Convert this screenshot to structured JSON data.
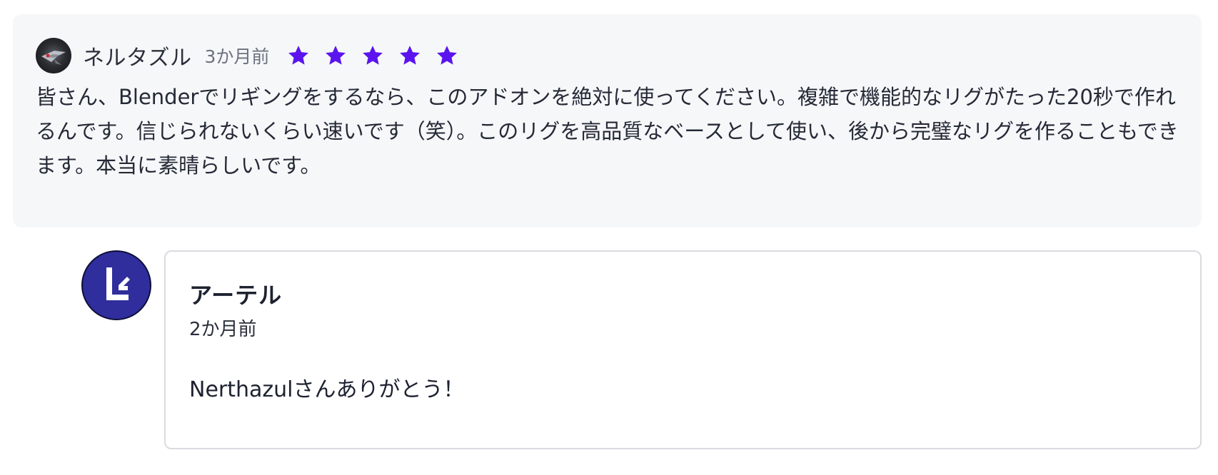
{
  "review": {
    "author": "ネルタズル",
    "time": "3か月前",
    "rating": 5,
    "max_rating": 5,
    "star_color": "#5b14ee",
    "avatar_icon": "reviewer-avatar",
    "body": "皆さん、Blenderでリギングをするなら、このアドオンを絶対に使ってください。複雑で機能的なリグがたった20秒で作れるんです。信じられないくらい速いです（笑）。このリグを高品質なベースとして使い、後から完璧なリグを作ることもできます。本当に素晴らしいです。"
  },
  "reply": {
    "author": "アーテル",
    "time": "2か月前",
    "text": "Nerthazulさんありがとう！",
    "avatar_icon": "brand-logo-icon",
    "avatar_color": "#2f2e9c"
  }
}
